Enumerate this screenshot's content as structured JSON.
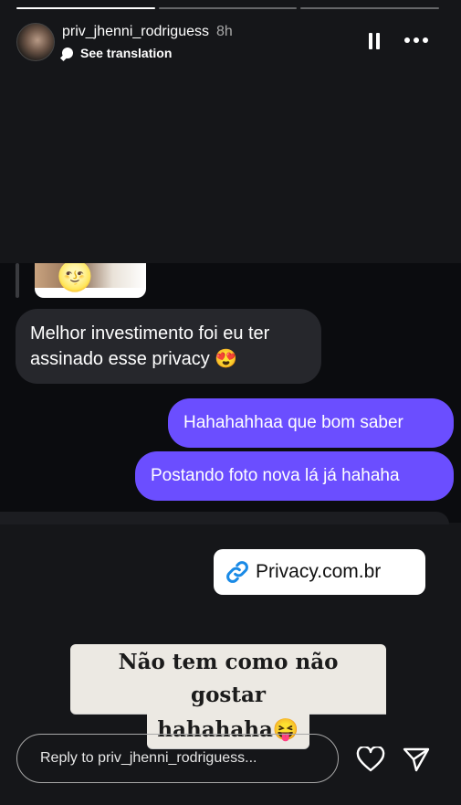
{
  "story": {
    "username": "priv_jhenni_rodriguess",
    "age": "8h",
    "see_translation": "See translation",
    "progress_segments": 3,
    "active_segment": 1
  },
  "chat": {
    "incoming_emoji": "🌝",
    "incoming": "Melhor investimento foi eu ter assinado esse privacy 😍",
    "outgoing": [
      "Hahahahhaa que bom saber",
      "Postando foto nova lá já hahaha"
    ]
  },
  "link_sticker": {
    "text": "Privacy.com.br",
    "icon": "link-icon",
    "color": "#1a8ae6"
  },
  "caption": {
    "line1": "Não tem como não gostar",
    "line2": "hahahaha😝"
  },
  "reply": {
    "placeholder": "Reply to priv_jhenni_rodriguess..."
  },
  "colors": {
    "outgoing_bubble": "#6b4eff",
    "incoming_bubble": "#26272c",
    "background": "#151619"
  }
}
